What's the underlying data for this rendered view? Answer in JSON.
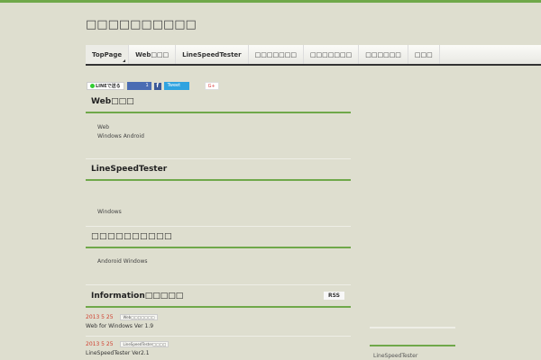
{
  "site_title": "□□□□□□□□□□",
  "nav": [
    "TopPage",
    "Web□□□",
    "LineSpeedTester",
    "□□□□□□□",
    "□□□□□□□",
    "□□□□□□",
    "□□□"
  ],
  "share": {
    "line": "LINEで送る",
    "like_count": "1",
    "facebook": "f",
    "tweet": "Tweet",
    "gplus": "G+"
  },
  "sections": [
    {
      "title": "Web□□□",
      "lines": [
        "Web",
        "Windows  Android"
      ]
    },
    {
      "title": "LineSpeedTester",
      "lines": [
        "Windows"
      ]
    },
    {
      "title": "□□□□□□□□□□",
      "lines": [
        "Andoroid  Windows"
      ]
    }
  ],
  "info": {
    "title": "Information□□□□□",
    "rss": "RSS",
    "items": [
      {
        "date": "2013 5 25",
        "tag": "Web□□□□□□□",
        "title": "Web    for Windows Ver 1.9"
      },
      {
        "date": "2013 5 25",
        "tag": "LineSpeedTester□□□□",
        "title": "LineSpeedTester Ver2.1"
      }
    ]
  },
  "sidebar": {
    "link": "LineSpeedTester"
  }
}
